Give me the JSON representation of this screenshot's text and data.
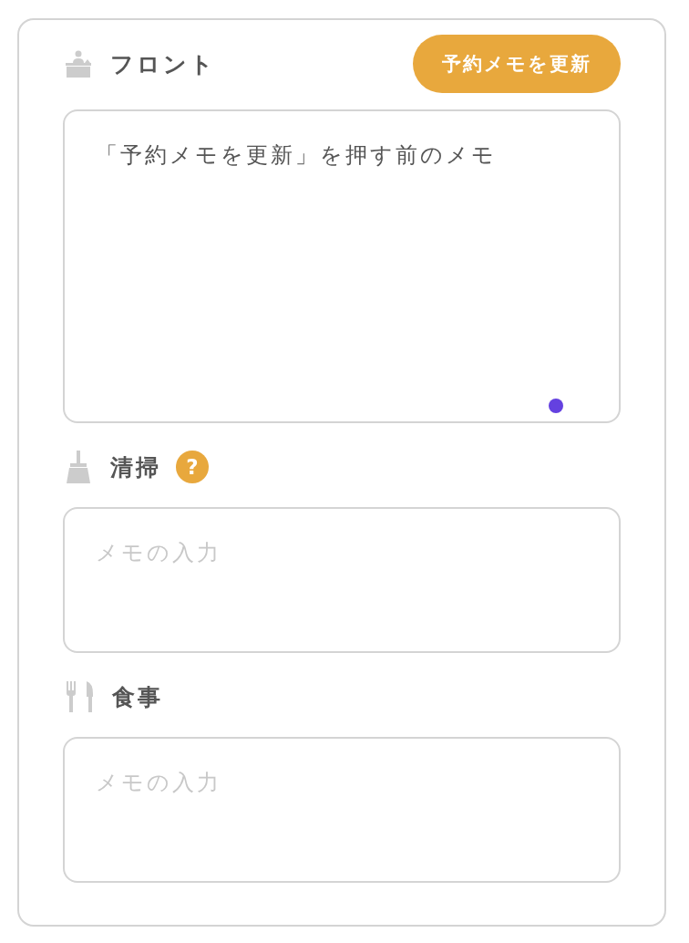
{
  "sections": [
    {
      "kind": "front",
      "title": "フロント",
      "button": "予約メモを更新",
      "memo": {
        "value": "「予約メモを更新」を押す前のメモ"
      }
    },
    {
      "kind": "cleaning",
      "title": "清掃",
      "help": "?",
      "memo": {
        "placeholder": "メモの入力"
      }
    },
    {
      "kind": "meal",
      "title": "食事",
      "memo": {
        "placeholder": "メモの入力"
      }
    }
  ]
}
